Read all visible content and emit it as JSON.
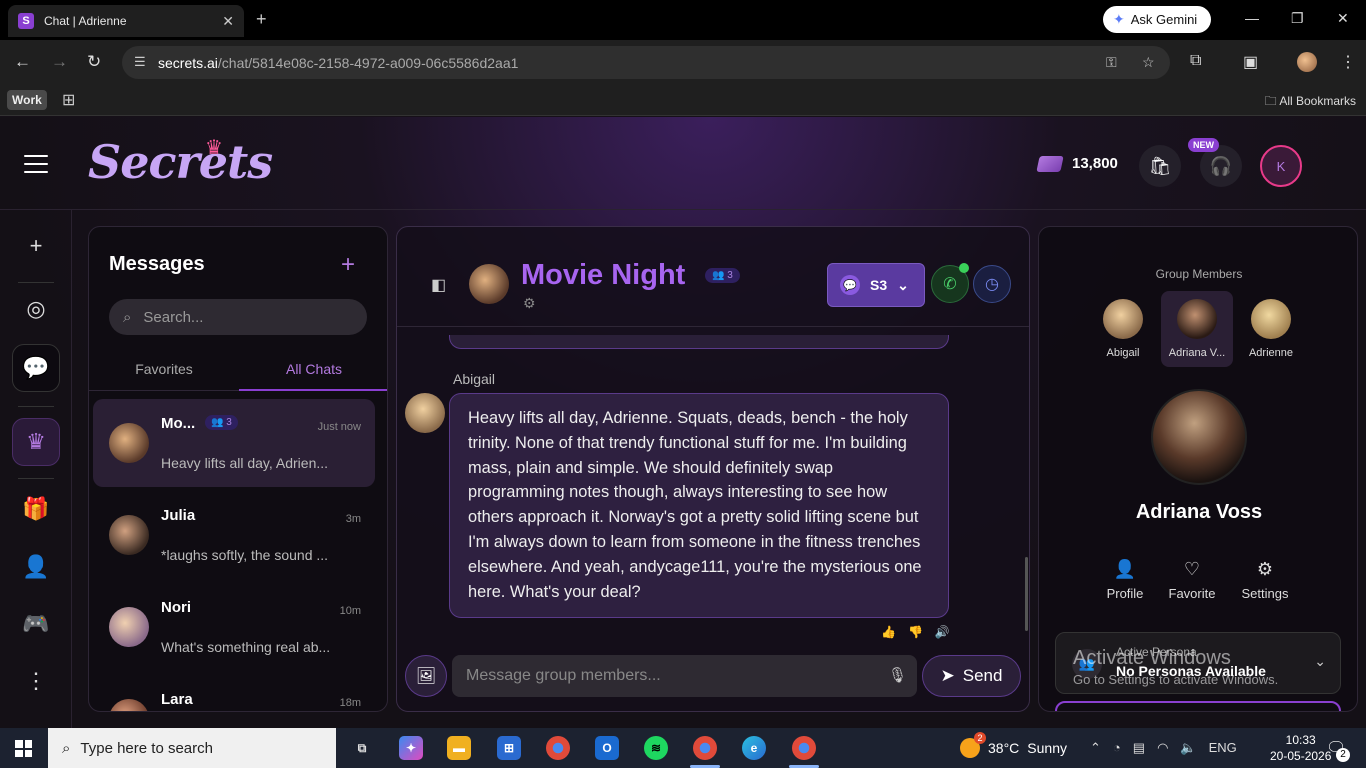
{
  "browser": {
    "tab_title": "Chat | Adrienne",
    "favicon_letter": "S",
    "gemini_label": "Ask Gemini",
    "url_host": "secrets.ai",
    "url_path": "/chat/5814e08c-2158-4972-a009-06c5586d2aa1",
    "workspace_label": "Work",
    "all_bookmarks": "All Bookmarks"
  },
  "header": {
    "logo": "Secrets",
    "coins": "13,800",
    "new_badge": "NEW",
    "avatar_letter": "K"
  },
  "messages_panel": {
    "title": "Messages",
    "search_placeholder": "Search...",
    "tabs": [
      "Favorites",
      "All Chats"
    ],
    "active_tab": "All Chats",
    "chats": [
      {
        "name": "Mo...",
        "count": "3",
        "time": "Just now",
        "preview": "Heavy lifts all day, Adrien..."
      },
      {
        "name": "Julia",
        "time": "3m",
        "preview": "*laughs softly, the sound ..."
      },
      {
        "name": "Nori",
        "time": "10m",
        "preview": "What's something real ab..."
      },
      {
        "name": "Lara",
        "time": "18m",
        "preview": ""
      }
    ]
  },
  "chat": {
    "group_name": "Movie Night",
    "member_count": "3",
    "model": "S3",
    "sender": "Abigail",
    "message": "Heavy lifts all day, Adrienne. Squats, deads, bench - the holy trinity. None of that trendy functional stuff for me. I'm building mass, plain and simple. We should definitely swap programming notes though, always interesting to see how others approach it. Norway's got a pretty solid lifting scene but I'm always down to learn from someone in the fitness trenches elsewhere. And yeah, andycage111, you're the mysterious one here. What's your deal?",
    "input_placeholder": "Message group members...",
    "send_label": "Send"
  },
  "right_panel": {
    "title": "Group Members",
    "members": [
      "Abigail",
      "Adriana V...",
      "Adrienne"
    ],
    "selected_member": "Adriana V...",
    "character_name": "Adriana Voss",
    "actions": [
      "Profile",
      "Favorite",
      "Settings"
    ],
    "persona_label": "Active Persona",
    "persona_value": "No Personas Available"
  },
  "watermark": {
    "line1": "Activate Windows",
    "line2": "Go to Settings to activate Windows."
  },
  "taskbar": {
    "search_placeholder": "Type here to search",
    "weather_temp": "38°C",
    "weather_desc": "Sunny",
    "weather_badge": "2",
    "lang": "ENG",
    "time": "10:33",
    "date": "20-05-2026",
    "notifications": "2"
  },
  "colors": {
    "accent": "#a865f0",
    "brand_pink": "#e83a8a",
    "bubble_bg": "#2e2040"
  }
}
